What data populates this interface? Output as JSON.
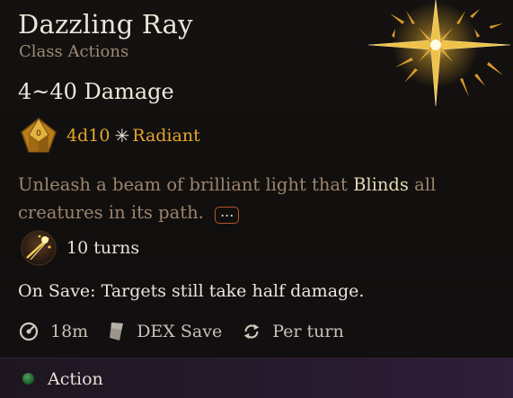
{
  "spell": {
    "title": "Dazzling Ray",
    "subtitle": "Class Actions",
    "damage": "4~40 Damage",
    "dice": "4d10",
    "damage_type": "Radiant",
    "damage_type_icon": "sparkle-icon",
    "desc_before": "Unleash a beam of brilliant light that ",
    "desc_keyword": "Blinds",
    "desc_after": " all creatures in its path.",
    "more_label": "...",
    "duration": "10 turns",
    "on_save": "On Save: Targets still take half damage."
  },
  "meta": {
    "range": "18m",
    "save": "DEX Save",
    "recharge": "Per turn"
  },
  "footer": {
    "action_label": "Action",
    "action_color": "#2f8a40"
  },
  "colors": {
    "title": "#ece5da",
    "subtitle": "#9d8a73",
    "damage_accent": "#e4a62e",
    "keyword": "#e5d9b4",
    "description": "#9c846d",
    "more_border": "#b3542c"
  }
}
